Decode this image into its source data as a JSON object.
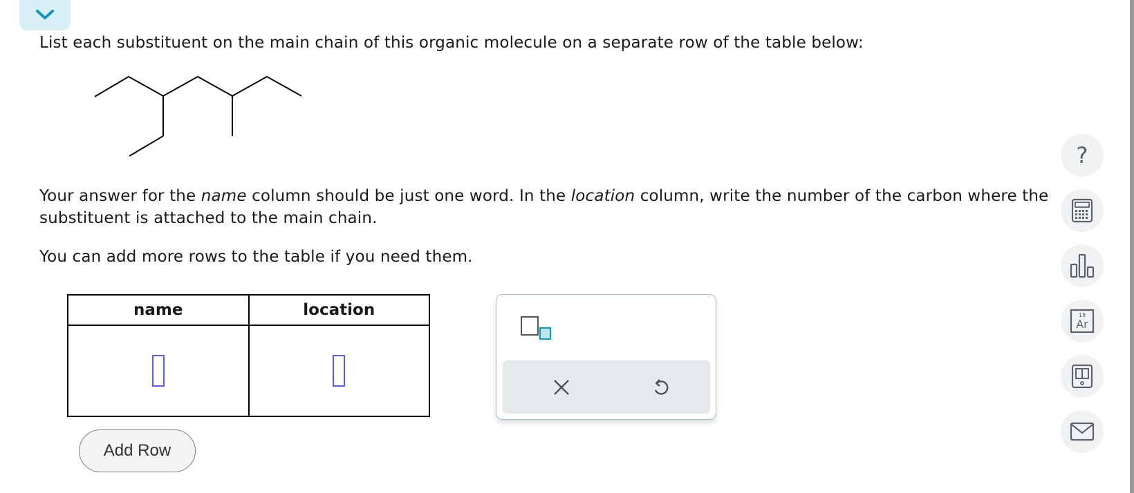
{
  "question": {
    "prompt": "List each substituent on the main chain of this organic molecule on a separate row of the table below:",
    "instructions_part1": "Your answer for the ",
    "instructions_name_term": "name",
    "instructions_part2": " column should be just one word. In the ",
    "instructions_location_term": "location",
    "instructions_part3": " column, write the number of the carbon where the substituent is attached to the main chain.",
    "add_rows_note": "You can add more rows to the table if you need them."
  },
  "table": {
    "columns": [
      "name",
      "location"
    ],
    "rows": [
      {
        "name": "",
        "location": ""
      }
    ]
  },
  "add_row_label": "Add Row",
  "palette": {
    "tools": [
      "subscript-template-icon"
    ],
    "actions": [
      "clear-icon",
      "undo-icon"
    ]
  },
  "side_toolbar": {
    "items": [
      "help-icon",
      "calculator-icon",
      "data-chart-icon",
      "periodic-table-icon",
      "reference-book-icon",
      "message-icon"
    ],
    "help_glyph": "?",
    "periodic_mass": "18",
    "periodic_symbol": "Ar"
  },
  "colors": {
    "accent": "#1496b8",
    "answer_slot": "#5b5ce0",
    "toolbar_icon": "#5c6468"
  }
}
